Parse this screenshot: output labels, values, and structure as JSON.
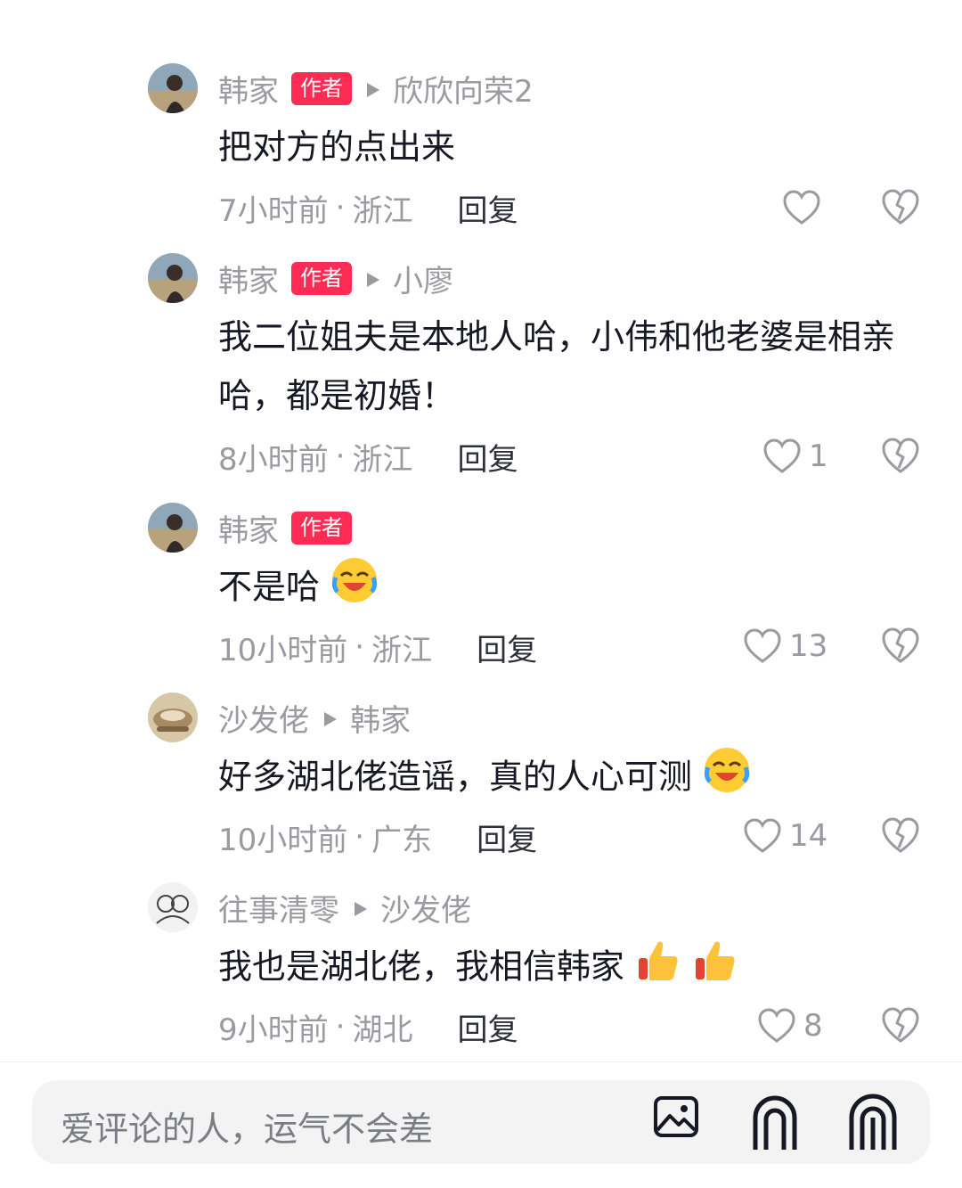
{
  "replies": [
    {
      "author": "韩家",
      "author_badge": "作者",
      "reply_to": "欣欣向荣2",
      "text": "把对方的点出来",
      "time": "7小时前",
      "sep": "·",
      "location": "浙江",
      "reply_label": "回复",
      "likes": ""
    },
    {
      "author": "韩家",
      "author_badge": "作者",
      "reply_to": "小廖",
      "text": "我二位姐夫是本地人哈，小伟和他老婆是相亲哈，都是初婚！",
      "time": "8小时前",
      "sep": "·",
      "location": "浙江",
      "reply_label": "回复",
      "likes": "1"
    },
    {
      "author": "韩家",
      "author_badge": "作者",
      "reply_to": "",
      "text": "不是哈",
      "emojis": [
        "laughing-crying-emoji"
      ],
      "time": "10小时前",
      "sep": "·",
      "location": "浙江",
      "reply_label": "回复",
      "likes": "13"
    },
    {
      "author": "沙发佬",
      "author_badge": "",
      "reply_to": "韩家",
      "text": "好多湖北佬造谣，真的人心可测",
      "emojis": [
        "laughing-crying-emoji"
      ],
      "time": "10小时前",
      "sep": "·",
      "location": "广东",
      "reply_label": "回复",
      "likes": "14"
    },
    {
      "author": "往事清零",
      "author_badge": "",
      "reply_to": "沙发佬",
      "text": "我也是湖北佬，我相信韩家",
      "emojis": [
        "thumbs-up-emoji",
        "thumbs-up-emoji"
      ],
      "time": "9小时前",
      "sep": "·",
      "location": "湖北",
      "reply_label": "回复",
      "likes": "8"
    }
  ],
  "composer": {
    "placeholder": "爱评论的人，运气不会差",
    "icons": [
      "image-icon",
      "at-mention-icon",
      "more-icon"
    ]
  },
  "colors": {
    "badge": "#fe2c55",
    "muted": "#9a9aa0",
    "text": "#161823"
  }
}
